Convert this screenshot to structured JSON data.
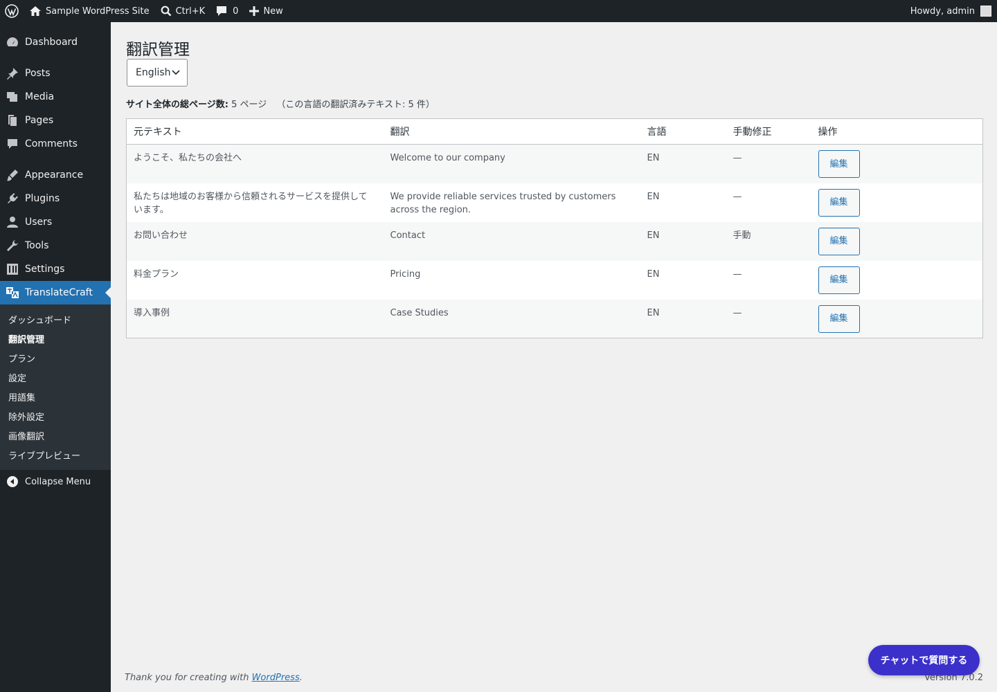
{
  "admin_bar": {
    "site_name": "Sample WordPress Site",
    "search_shortcut": "Ctrl+K",
    "comments_count": "0",
    "new_label": "New",
    "greeting": "Howdy, admin"
  },
  "sidebar": {
    "items": [
      {
        "label": "Dashboard",
        "icon": "dashboard-icon"
      },
      {
        "label": "Posts",
        "icon": "pin-icon"
      },
      {
        "label": "Media",
        "icon": "media-icon"
      },
      {
        "label": "Pages",
        "icon": "pages-icon"
      },
      {
        "label": "Comments",
        "icon": "comment-icon"
      },
      {
        "label": "Appearance",
        "icon": "brush-icon"
      },
      {
        "label": "Plugins",
        "icon": "plugin-icon"
      },
      {
        "label": "Users",
        "icon": "user-icon"
      },
      {
        "label": "Tools",
        "icon": "wrench-icon"
      },
      {
        "label": "Settings",
        "icon": "settings-icon"
      },
      {
        "label": "TranslateCraft",
        "icon": "translate-icon"
      }
    ],
    "submenu": [
      "ダッシュボード",
      "翻訳管理",
      "プラン",
      "設定",
      "用語集",
      "除外設定",
      "画像翻訳",
      "ライブプレビュー"
    ],
    "collapse_label": "Collapse Menu"
  },
  "page": {
    "title": "翻訳管理",
    "language_select": "English",
    "summary_label": "サイト全体の総ページ数:",
    "summary_value": "5 ページ",
    "summary_sub": "（この言語の翻訳済みテキスト: 5 件）"
  },
  "table": {
    "headers": [
      "元テキスト",
      "翻訳",
      "言語",
      "手動修正",
      "操作"
    ],
    "rows": [
      {
        "source": "ようこそ、私たちの会社へ",
        "translation": "Welcome to our company",
        "lang": "EN",
        "manual": "—",
        "action": "編集"
      },
      {
        "source": "私たちは地域のお客様から信頼されるサービスを提供しています。",
        "translation": "We provide reliable services trusted by customers across the region.",
        "lang": "EN",
        "manual": "—",
        "action": "編集"
      },
      {
        "source": "お問い合わせ",
        "translation": "Contact",
        "lang": "EN",
        "manual": "手動",
        "action": "編集"
      },
      {
        "source": "料金プラン",
        "translation": "Pricing",
        "lang": "EN",
        "manual": "—",
        "action": "編集"
      },
      {
        "source": "導入事例",
        "translation": "Case Studies",
        "lang": "EN",
        "manual": "—",
        "action": "編集"
      }
    ]
  },
  "footer": {
    "thanks_prefix": "Thank you for creating with ",
    "thanks_link": "WordPress",
    "thanks_suffix": ".",
    "version": "Version 7.0.2"
  },
  "chat_button": "チャットで質問する",
  "colors": {
    "admin_dark": "#1d2327",
    "accent": "#2271b1",
    "chat": "#3b30c9"
  }
}
